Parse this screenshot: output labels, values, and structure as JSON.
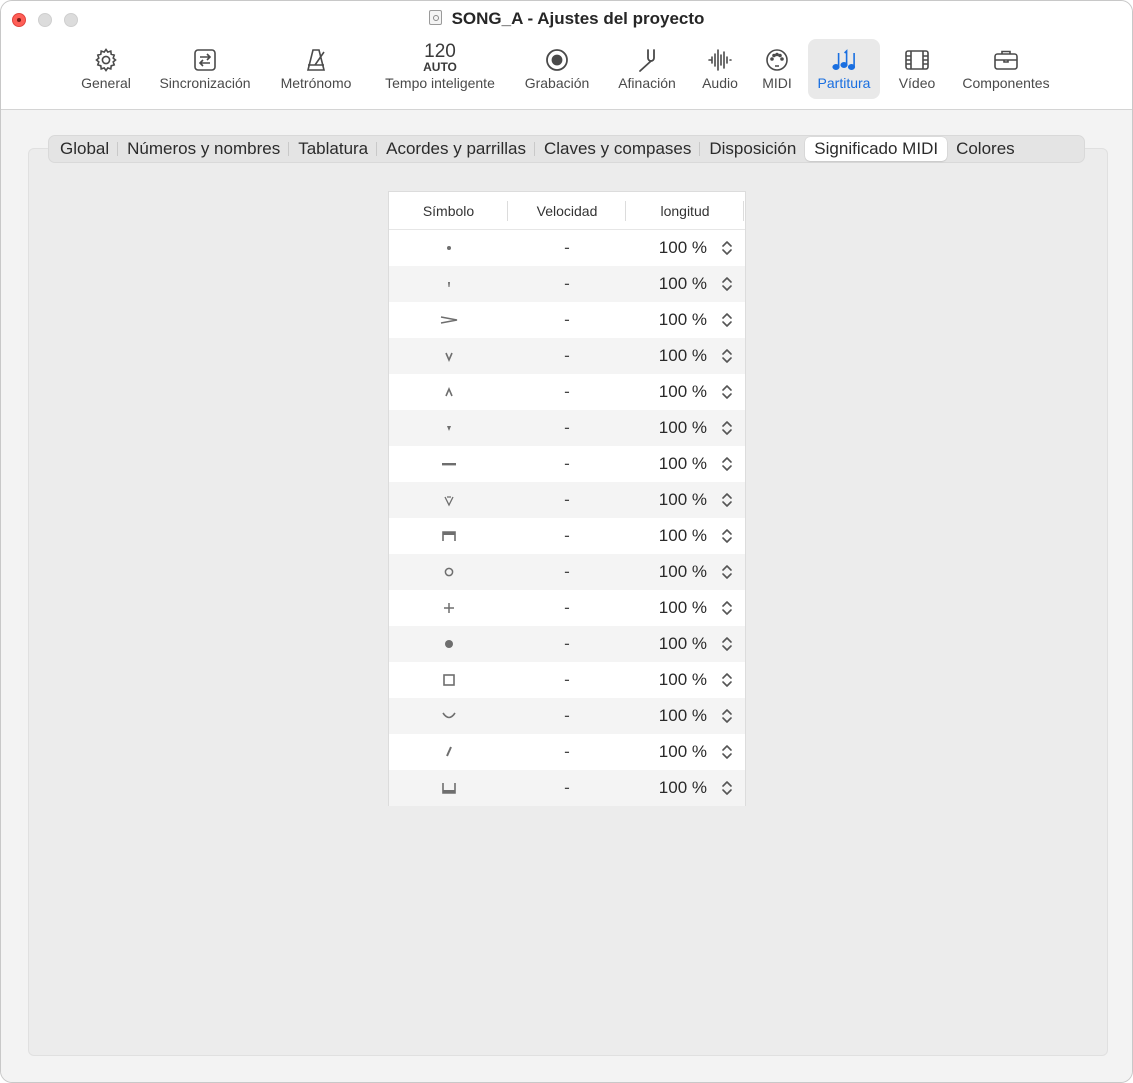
{
  "window": {
    "title": "SONG_A - Ajustes del proyecto"
  },
  "toolbar": {
    "items": [
      {
        "label": "General",
        "icon": "gear-icon"
      },
      {
        "label": "Sincronización",
        "icon": "sync-icon"
      },
      {
        "label": "Metrónomo",
        "icon": "metronome-icon"
      },
      {
        "label": "Tempo inteligente",
        "icon": "tempo-icon",
        "tempo_value": "120",
        "tempo_mode": "AUTO"
      },
      {
        "label": "Grabación",
        "icon": "record-icon"
      },
      {
        "label": "Afinación",
        "icon": "tuning-fork-icon"
      },
      {
        "label": "Audio",
        "icon": "waveform-icon"
      },
      {
        "label": "MIDI",
        "icon": "midi-port-icon"
      },
      {
        "label": "Partitura",
        "icon": "music-notes-icon",
        "selected": true
      },
      {
        "label": "Vídeo",
        "icon": "film-icon"
      },
      {
        "label": "Componentes",
        "icon": "briefcase-icon"
      }
    ],
    "accent_color": "#1a6fe0"
  },
  "tabs": [
    {
      "label": "Global"
    },
    {
      "label": "Números y nombres"
    },
    {
      "label": "Tablatura"
    },
    {
      "label": "Acordes y parrillas"
    },
    {
      "label": "Claves y compases"
    },
    {
      "label": "Disposición"
    },
    {
      "label": "Significado MIDI",
      "active": true
    },
    {
      "label": "Colores"
    }
  ],
  "table": {
    "columns": {
      "symbol": "Símbolo",
      "velocity": "Velocidad",
      "length": "longitud"
    },
    "rows": [
      {
        "symbol": "staccato-dot-icon",
        "velocity": "-",
        "length": "100 %"
      },
      {
        "symbol": "staccatissimo-wedge-icon",
        "velocity": "-",
        "length": "100 %"
      },
      {
        "symbol": "accent-icon",
        "velocity": "-",
        "length": "100 %"
      },
      {
        "symbol": "marcato-down-icon",
        "velocity": "-",
        "length": "100 %"
      },
      {
        "symbol": "marcato-up-icon",
        "velocity": "-",
        "length": "100 %"
      },
      {
        "symbol": "small-wedge-icon",
        "velocity": "-",
        "length": "100 %"
      },
      {
        "symbol": "tenuto-icon",
        "velocity": "-",
        "length": "100 %"
      },
      {
        "symbol": "open-marcato-icon",
        "velocity": "-",
        "length": "100 %"
      },
      {
        "symbol": "down-bow-icon",
        "velocity": "-",
        "length": "100 %"
      },
      {
        "symbol": "harmonic-circle-icon",
        "velocity": "-",
        "length": "100 %"
      },
      {
        "symbol": "plus-icon",
        "velocity": "-",
        "length": "100 %"
      },
      {
        "symbol": "filled-dot-icon",
        "velocity": "-",
        "length": "100 %"
      },
      {
        "symbol": "square-icon",
        "velocity": "-",
        "length": "100 %"
      },
      {
        "symbol": "bend-arc-icon",
        "velocity": "-",
        "length": "100 %"
      },
      {
        "symbol": "slash-icon",
        "velocity": "-",
        "length": "100 %"
      },
      {
        "symbol": "bracket-icon",
        "velocity": "-",
        "length": "100 %"
      }
    ]
  }
}
